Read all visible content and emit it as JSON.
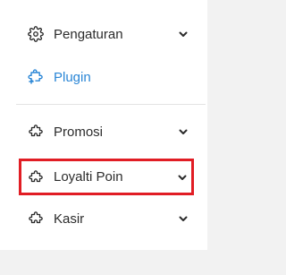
{
  "menu": {
    "items": [
      {
        "label": "Pengaturan",
        "icon": "gear-icon",
        "has_chevron": true
      },
      {
        "label": "Plugin",
        "icon": "puzzle-plus-icon",
        "has_chevron": false,
        "active": true
      },
      {
        "label": "Promosi",
        "icon": "puzzle-icon",
        "has_chevron": true
      },
      {
        "label": "Loyalti Poin",
        "icon": "puzzle-icon",
        "has_chevron": true,
        "highlighted": true
      },
      {
        "label": "Kasir",
        "icon": "puzzle-icon",
        "has_chevron": true
      }
    ]
  },
  "colors": {
    "accent": "#2a86d6",
    "highlight_border": "#e11d24",
    "text": "#2b2b2b"
  }
}
